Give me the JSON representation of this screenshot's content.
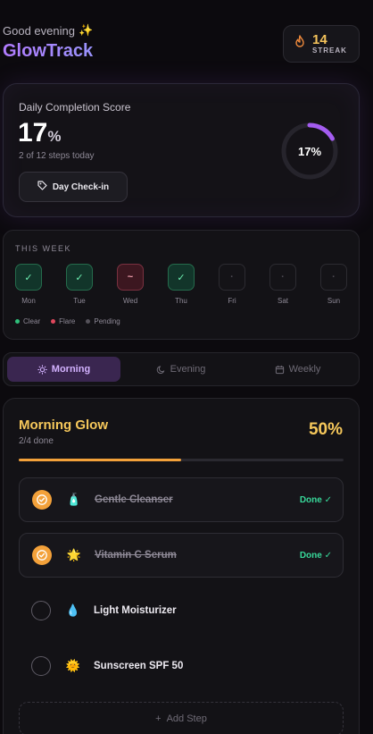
{
  "header": {
    "greeting": "Good evening",
    "greeting_emoji": "✨",
    "brand": "GlowTrack",
    "streak_count": "14",
    "streak_label": "STREAK"
  },
  "score": {
    "title": "Daily Completion Score",
    "value": "17",
    "unit": "%",
    "subtitle": "2 of 12 steps today",
    "checkin_label": "Day Check-in",
    "ring_label": "17%",
    "ring_fraction": 0.17
  },
  "week": {
    "title": "THIS WEEK",
    "days": [
      {
        "name": "Mon",
        "status": "clear",
        "glyph": "✓"
      },
      {
        "name": "Tue",
        "status": "clear",
        "glyph": "✓"
      },
      {
        "name": "Wed",
        "status": "flare",
        "glyph": "~"
      },
      {
        "name": "Thu",
        "status": "clear",
        "glyph": "✓"
      },
      {
        "name": "Fri",
        "status": "pending",
        "glyph": "·"
      },
      {
        "name": "Sat",
        "status": "pending",
        "glyph": "·"
      },
      {
        "name": "Sun",
        "status": "pending",
        "glyph": "·"
      }
    ],
    "legend": [
      {
        "label": "Clear",
        "color": "#2fbf7a"
      },
      {
        "label": "Flare",
        "color": "#e0475c"
      },
      {
        "label": "Pending",
        "color": "#55525a"
      }
    ]
  },
  "tabs": [
    {
      "label": "Morning",
      "icon": "sun-icon",
      "active": true
    },
    {
      "label": "Evening",
      "icon": "moon-icon",
      "active": false
    },
    {
      "label": "Weekly",
      "icon": "calendar-icon",
      "active": false
    }
  ],
  "routine": {
    "title": "Morning Glow",
    "subtitle": "2/4 done",
    "percent_label": "50%",
    "progress": 0.5,
    "steps": [
      {
        "label": "Gentle Cleanser",
        "emoji": "🧴",
        "done": true,
        "status": "Done ✓"
      },
      {
        "label": "Vitamin C Serum",
        "emoji": "🌟",
        "done": true,
        "status": "Done ✓"
      },
      {
        "label": "Light Moisturizer",
        "emoji": "💧",
        "done": false,
        "status": ""
      },
      {
        "label": "Sunscreen SPF 50",
        "emoji": "🌞",
        "done": false,
        "status": ""
      }
    ],
    "add_label": "Add Step"
  },
  "colors": {
    "accent_purple": "#b27cff",
    "accent_orange": "#f3a13a",
    "accent_yellow": "#f6c85b",
    "done_green": "#38d89a"
  }
}
